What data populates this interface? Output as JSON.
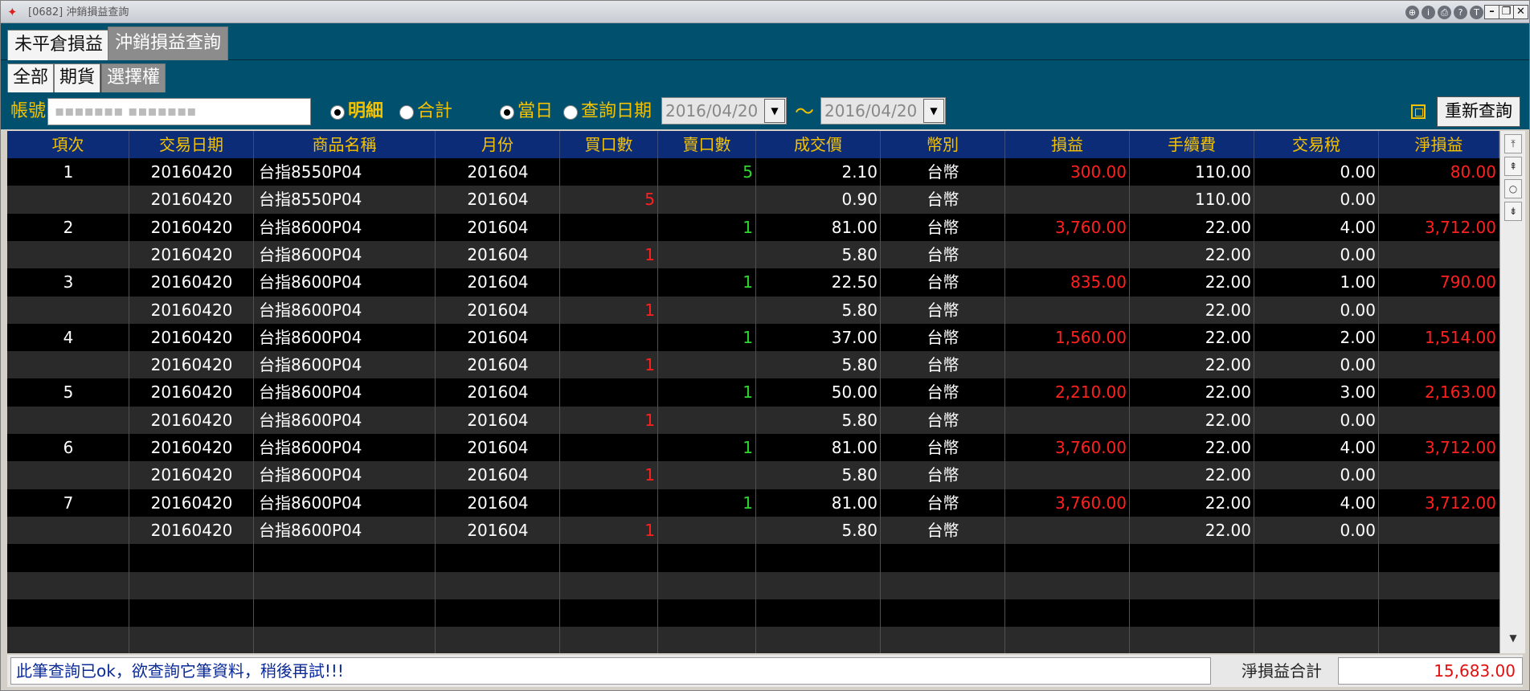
{
  "window": {
    "title": "[0682] 沖銷損益查詢"
  },
  "tabs_main": [
    "未平倉損益",
    "沖銷損益查詢"
  ],
  "tabs_sub": [
    "全部",
    "期貨",
    "選擇權"
  ],
  "toolbar": {
    "account_label": "帳號",
    "account_value": "▪▪▪▪▪▪▪ ▪▪▪▪▪▪▪",
    "radio_detail": "明細",
    "radio_total": "合計",
    "radio_today": "當日",
    "radio_query_date": "查詢日期",
    "date_from": "2016/04/20",
    "date_to": "2016/04/20",
    "tilde": "～",
    "requery_label": "重新查詢"
  },
  "table": {
    "headers": [
      "項次",
      "交易日期",
      "商品名稱",
      "月份",
      "買口數",
      "賣口數",
      "成交價",
      "幣別",
      "損益",
      "手續費",
      "交易稅",
      "淨損益"
    ],
    "rows": [
      [
        "1",
        "20160420",
        "台指8550P04",
        "201604",
        "",
        "5",
        "2.10",
        "台幣",
        "300.00",
        "110.00",
        "0.00",
        "80.00"
      ],
      [
        "",
        "20160420",
        "台指8550P04",
        "201604",
        "5",
        "",
        "0.90",
        "台幣",
        "",
        "110.00",
        "0.00",
        ""
      ],
      [
        "2",
        "20160420",
        "台指8600P04",
        "201604",
        "",
        "1",
        "81.00",
        "台幣",
        "3,760.00",
        "22.00",
        "4.00",
        "3,712.00"
      ],
      [
        "",
        "20160420",
        "台指8600P04",
        "201604",
        "1",
        "",
        "5.80",
        "台幣",
        "",
        "22.00",
        "0.00",
        ""
      ],
      [
        "3",
        "20160420",
        "台指8600P04",
        "201604",
        "",
        "1",
        "22.50",
        "台幣",
        "835.00",
        "22.00",
        "1.00",
        "790.00"
      ],
      [
        "",
        "20160420",
        "台指8600P04",
        "201604",
        "1",
        "",
        "5.80",
        "台幣",
        "",
        "22.00",
        "0.00",
        ""
      ],
      [
        "4",
        "20160420",
        "台指8600P04",
        "201604",
        "",
        "1",
        "37.00",
        "台幣",
        "1,560.00",
        "22.00",
        "2.00",
        "1,514.00"
      ],
      [
        "",
        "20160420",
        "台指8600P04",
        "201604",
        "1",
        "",
        "5.80",
        "台幣",
        "",
        "22.00",
        "0.00",
        ""
      ],
      [
        "5",
        "20160420",
        "台指8600P04",
        "201604",
        "",
        "1",
        "50.00",
        "台幣",
        "2,210.00",
        "22.00",
        "3.00",
        "2,163.00"
      ],
      [
        "",
        "20160420",
        "台指8600P04",
        "201604",
        "1",
        "",
        "5.80",
        "台幣",
        "",
        "22.00",
        "0.00",
        ""
      ],
      [
        "6",
        "20160420",
        "台指8600P04",
        "201604",
        "",
        "1",
        "81.00",
        "台幣",
        "3,760.00",
        "22.00",
        "4.00",
        "3,712.00"
      ],
      [
        "",
        "20160420",
        "台指8600P04",
        "201604",
        "1",
        "",
        "5.80",
        "台幣",
        "",
        "22.00",
        "0.00",
        ""
      ],
      [
        "7",
        "20160420",
        "台指8600P04",
        "201604",
        "",
        "1",
        "81.00",
        "台幣",
        "3,760.00",
        "22.00",
        "4.00",
        "3,712.00"
      ],
      [
        "",
        "20160420",
        "台指8600P04",
        "201604",
        "1",
        "",
        "5.80",
        "台幣",
        "",
        "22.00",
        "0.00",
        ""
      ]
    ],
    "empty_rows": 4
  },
  "status": {
    "message": "此筆查詢已ok，欲查詢它筆資料，稍後再試!!!",
    "net_label": "淨損益合計",
    "net_value": "15,683.00"
  },
  "colors": {
    "header_bg": "#0c2c78",
    "header_text": "#f5c200",
    "toolbar_bg": "#00506e",
    "buy": "#ff2020",
    "sell": "#2ed82e",
    "profit": "#ff2020"
  }
}
